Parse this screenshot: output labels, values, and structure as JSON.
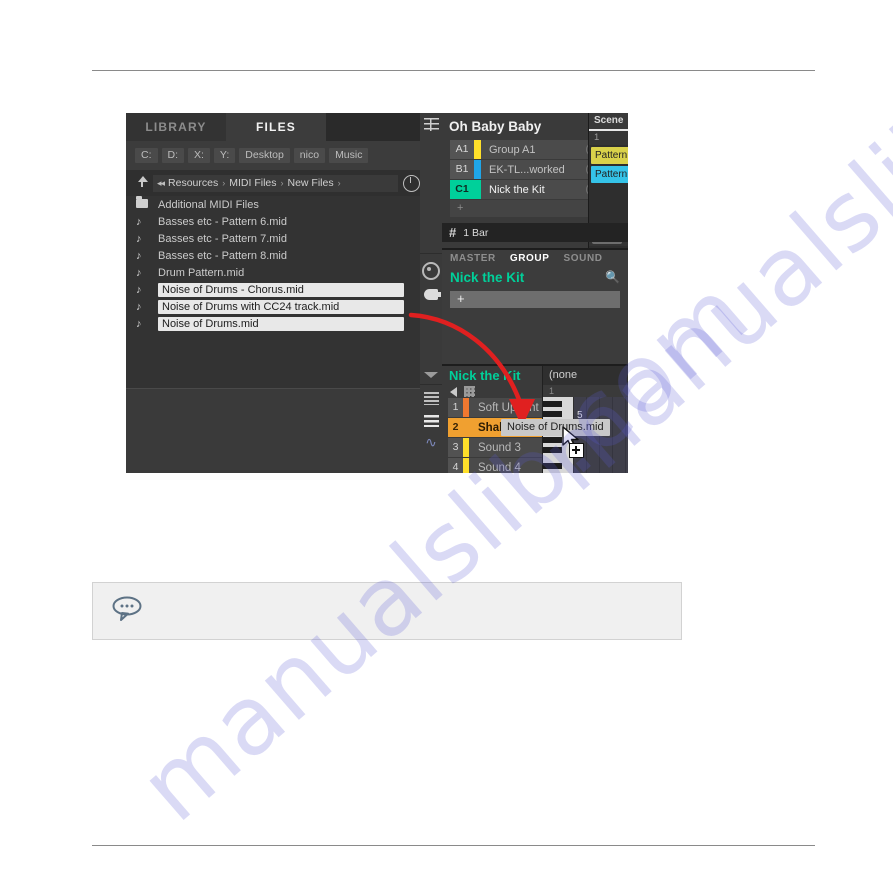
{
  "browser": {
    "tabs": [
      {
        "label": "LIBRARY",
        "active": false
      },
      {
        "label": "FILES",
        "active": true
      }
    ],
    "drives": [
      "C:",
      "D:",
      "X:",
      "Y:",
      "Desktop",
      "nico",
      "Music"
    ],
    "path": {
      "up_icon": "up-arrow-icon",
      "prev_icon": "previous-icon",
      "crumbs": [
        "Resources",
        "MIDI Files",
        "New Files"
      ],
      "separator": "›",
      "recent_icon": "recent-clock-icon"
    },
    "files": [
      {
        "name": "Additional MIDI Files",
        "type": "folder",
        "selected": false
      },
      {
        "name": "Basses etc - Pattern 6.mid",
        "type": "midi",
        "selected": false
      },
      {
        "name": "Basses etc - Pattern 7.mid",
        "type": "midi",
        "selected": false
      },
      {
        "name": "Basses etc - Pattern 8.mid",
        "type": "midi",
        "selected": false
      },
      {
        "name": "Drum Pattern.mid",
        "type": "midi",
        "selected": false
      },
      {
        "name": "Noise of Drums - Chorus.mid",
        "type": "midi",
        "selected": true
      },
      {
        "name": "Noise of Drums with CC24 track.mid",
        "type": "midi",
        "selected": true
      },
      {
        "name": "Noise of Drums.mid",
        "type": "midi",
        "selected": true
      }
    ],
    "file_icon": "music-note-icon"
  },
  "arranger": {
    "icon_column": [
      {
        "name": "arrange-grid-icon"
      },
      {
        "name": "record-circle-icon"
      },
      {
        "name": "plug-icon"
      },
      {
        "name": "collapse-caret-icon"
      },
      {
        "name": "list-lines-icon"
      },
      {
        "name": "mixer-icon"
      },
      {
        "name": "waveform-icon"
      }
    ],
    "project": {
      "title": "Oh Baby Baby",
      "dropdown_icon": "chevron-down-icon"
    },
    "groups": [
      {
        "tag": "A1",
        "name": "Group A1",
        "color": "#ffe02a",
        "selected": false
      },
      {
        "tag": "B1",
        "name": "EK-TL...worked",
        "color": "#1fa6e8",
        "selected": false
      },
      {
        "tag": "C1",
        "name": "Nick the Kit",
        "color": "#00d09a",
        "selected": true
      }
    ],
    "group_add_label": "+",
    "knob_icons": [
      "mute-knob-icon",
      "solo-knob-icon"
    ],
    "length": {
      "icon": "grid-hash-icon",
      "label": "1 Bar"
    },
    "scene": {
      "header": "Scene",
      "number": "1",
      "patterns": [
        {
          "label": "Pattern",
          "color": "#d9d14a"
        },
        {
          "label": "Pattern",
          "color": "#35c3e8"
        }
      ],
      "scrollbar": "horizontal-scrollbar"
    },
    "control": {
      "tabs": [
        {
          "label": "MASTER",
          "active": false
        },
        {
          "label": "GROUP",
          "active": true
        },
        {
          "label": "SOUND",
          "active": false
        }
      ],
      "name": "Nick the Kit",
      "search_icon": "magnifier-icon",
      "slot_add": "+"
    },
    "sound_panel": {
      "title": "Nick the Kit",
      "dropdown_icon": "chevron-down-icon",
      "speaker_icon": "speaker-icon",
      "pad_grid_icon": "pad-grid-icon",
      "sounds": [
        {
          "num": "1",
          "name": "Soft Upright",
          "color": "#f07830",
          "selected": false
        },
        {
          "num": "2",
          "name": "Shakuhachi",
          "color": "#f0a030",
          "selected": true
        },
        {
          "num": "3",
          "name": "Sound 3",
          "color": "#ffe02a",
          "selected": false
        },
        {
          "num": "4",
          "name": "Sound 4",
          "color": "#ffe02a",
          "selected": false
        }
      ],
      "right_header": "(none",
      "right_sub": "1",
      "ruler_mark": "5"
    }
  },
  "drag": {
    "tooltip": "Noise of Drums.mid",
    "cursor_icon": "drag-cursor-icon",
    "add_badge_icon": "plus-badge-icon",
    "arrow_icon": "red-arrow-annotation",
    "arrow_color": "#e02020"
  },
  "tip": {
    "icon": "speech-bubble-tip-icon",
    "text": ""
  },
  "watermark": {
    "text": "manualslib.com"
  },
  "colors": {
    "accent_green": "#00d09a",
    "accent_orange": "#f0a030",
    "annotation_red": "#e02020"
  }
}
